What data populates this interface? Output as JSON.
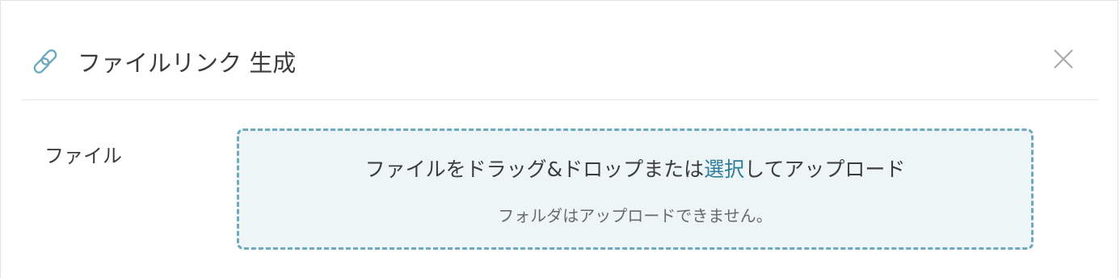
{
  "dialog": {
    "title": "ファイルリンク 生成",
    "title_icon": "link-icon",
    "close_icon": "close-icon",
    "accent_color": "#6fa9bd",
    "link_color": "#2f7d99"
  },
  "form": {
    "file_label": "ファイル"
  },
  "dropzone": {
    "text_before": "ファイルをドラッグ&ドロップまたは",
    "select_link": "選択",
    "text_after": "してアップロード",
    "note": "フォルダはアップロードできません。"
  }
}
